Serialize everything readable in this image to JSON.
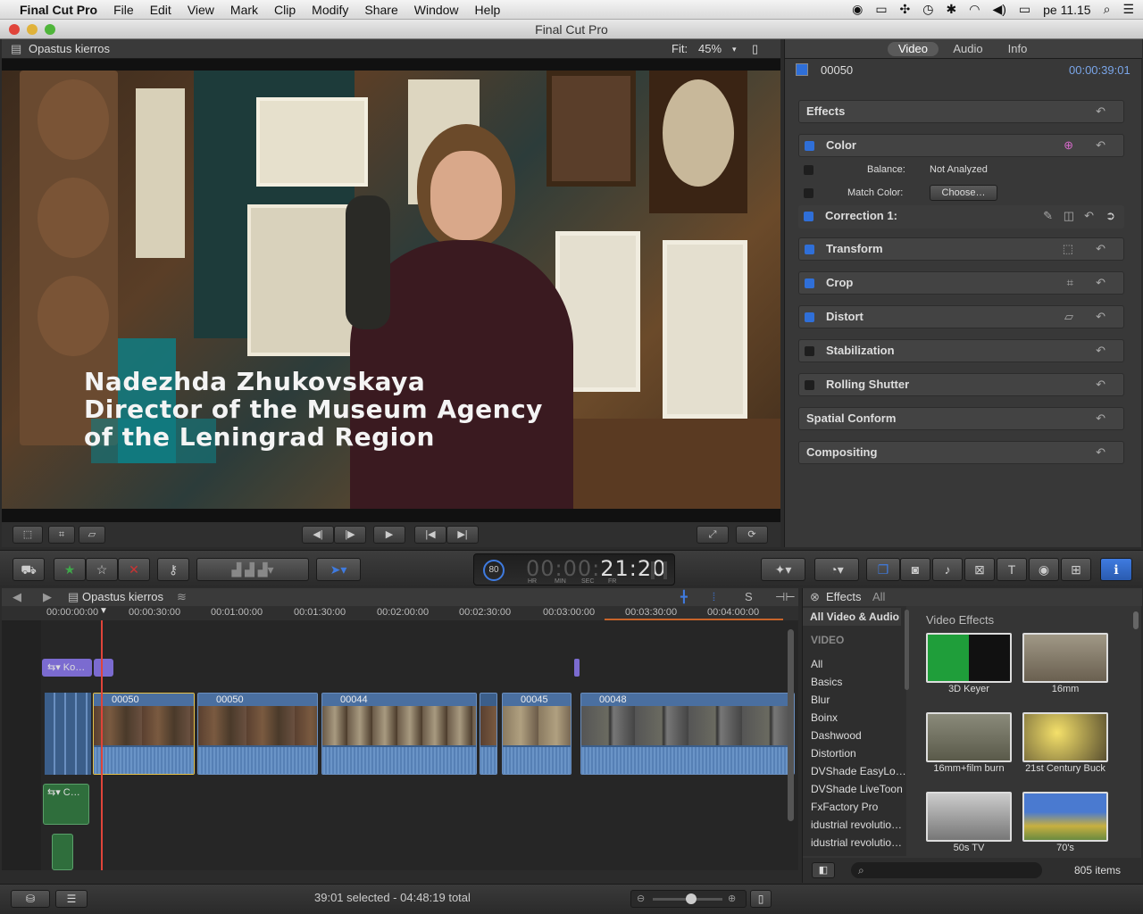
{
  "menubar": {
    "app": "Final Cut Pro",
    "items": [
      "File",
      "Edit",
      "View",
      "Mark",
      "Clip",
      "Modify",
      "Share",
      "Window",
      "Help"
    ],
    "clock": "pe 11.15"
  },
  "window": {
    "title": "Final Cut Pro"
  },
  "viewer": {
    "project": "Opastus kierros",
    "fit_label": "Fit:",
    "zoom": "45%",
    "lower_third": {
      "line1": "Nadezhda Zhukovskaya",
      "line2": "Director of the Museum Agency",
      "line3": "of the Leningrad Region"
    }
  },
  "inspector": {
    "tabs": [
      "Video",
      "Audio",
      "Info"
    ],
    "clip_name": "00050",
    "timecode": "00:00:39:01",
    "sections": {
      "effects": "Effects",
      "color": "Color",
      "balance_label": "Balance:",
      "balance_value": "Not Analyzed",
      "match_color_label": "Match Color:",
      "choose_button": "Choose…",
      "correction": "Correction 1:",
      "transform": "Transform",
      "crop": "Crop",
      "distort": "Distort",
      "stabilization": "Stabilization",
      "rolling_shutter": "Rolling Shutter",
      "spatial_conform": "Spatial Conform",
      "compositing": "Compositing"
    }
  },
  "toolbar": {
    "timecode": "00:00:21:20",
    "timecode_dim": "00:00:",
    "timecode_bright": "21:20",
    "tc_units": [
      "HR",
      "MIN",
      "SEC",
      "FR"
    ],
    "dial": "80"
  },
  "timeline": {
    "project": "Opastus kierros",
    "ruler": [
      "00:00:00:00",
      "00:00:30:00",
      "00:01:00:00",
      "00:01:30:00",
      "00:02:00:00",
      "00:02:30:00",
      "00:03:00:00",
      "00:03:30:00",
      "00:04:00:00"
    ],
    "title_clip": "Ko…",
    "audio_clip": "C…",
    "clips": [
      "00050",
      "00050",
      "00044",
      "00045",
      "00048"
    ]
  },
  "effects_browser": {
    "title": "Effects",
    "filter": "All",
    "selected_category": "All Video & Audio",
    "group_header": "VIDEO",
    "categories": [
      "All",
      "Basics",
      "Blur",
      "Boinx",
      "Dashwood",
      "Distortion",
      "DVShade EasyLo…",
      "DVShade LiveToon",
      "FxFactory Pro",
      "idustrial revolutio…",
      "idustrial revolutio…"
    ],
    "section_title": "Video Effects",
    "effects": [
      "3D Keyer",
      "16mm",
      "16mm+film burn",
      "21st Century Buck",
      "50s TV",
      "70's"
    ],
    "count": "805 items"
  },
  "status": {
    "selection": "39:01 selected - 04:48:19 total"
  },
  "colors": {
    "accent": "#2f6fd8",
    "playhead": "#e0443a"
  }
}
